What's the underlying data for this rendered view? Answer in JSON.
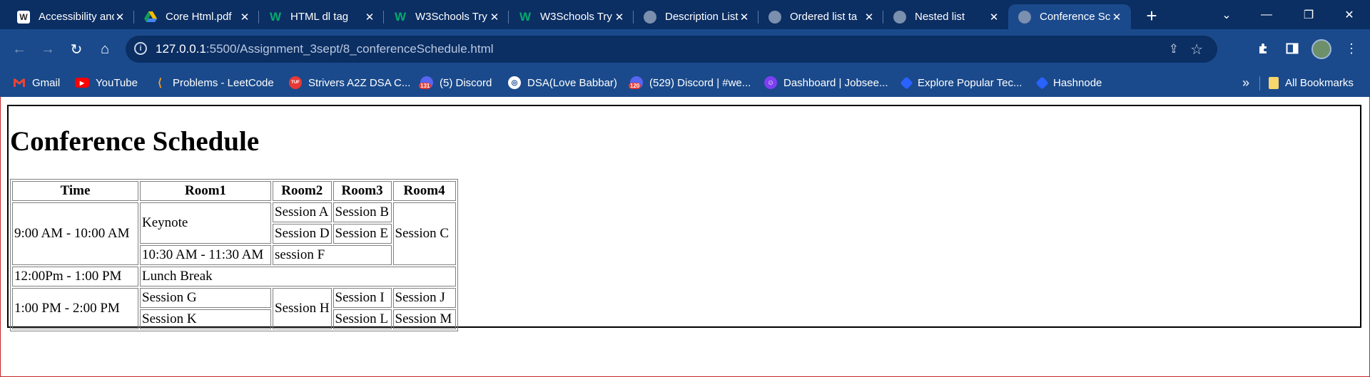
{
  "tabs": [
    {
      "title": "Accessibility and",
      "icon": "wordpress-icon",
      "active": false
    },
    {
      "title": "Core Html.pdf",
      "icon": "google-drive-icon",
      "active": false
    },
    {
      "title": "HTML dl tag",
      "icon": "w3schools-icon",
      "active": false
    },
    {
      "title": "W3Schools Try",
      "icon": "w3schools-icon",
      "active": false
    },
    {
      "title": "W3Schools Try",
      "icon": "w3schools-icon",
      "active": false
    },
    {
      "title": "Description List",
      "icon": "globe-icon",
      "active": false
    },
    {
      "title": "Ordered list ta",
      "icon": "globe-icon",
      "active": false
    },
    {
      "title": "Nested list",
      "icon": "globe-icon",
      "active": false
    },
    {
      "title": "Conference Sc",
      "icon": "globe-icon",
      "active": true
    }
  ],
  "address": {
    "host": "127.0.0.1",
    "path": ":5500/Assignment_3sept/8_conferenceSchedule.html"
  },
  "bookmarks": [
    {
      "label": "Gmail",
      "icon": "gmail-icon",
      "color": "#ea4335"
    },
    {
      "label": "YouTube",
      "icon": "youtube-icon",
      "color": "#ff0000"
    },
    {
      "label": "Problems - LeetCode",
      "icon": "leetcode-icon",
      "color": "#ffa116"
    },
    {
      "label": "Strivers A2Z DSA C...",
      "icon": "tuf-icon",
      "color": "#e53935"
    },
    {
      "label": "(5) Discord",
      "icon": "discord-icon",
      "badge": "131",
      "color": "#5865f2"
    },
    {
      "label": "DSA(Love Babbar)",
      "icon": "codehelp-icon",
      "color": "#ffffff"
    },
    {
      "label": "(529) Discord | #we...",
      "icon": "discord-icon",
      "badge": "120",
      "color": "#5865f2"
    },
    {
      "label": "Dashboard | Jobsee...",
      "icon": "jobseeker-icon",
      "color": "#7e3ff2"
    },
    {
      "label": "Explore Popular Tec...",
      "icon": "diamond-icon",
      "color": "#2962ff"
    },
    {
      "label": "Hashnode",
      "icon": "hashnode-icon",
      "color": "#2962ff"
    }
  ],
  "bookmarks_more": "»",
  "all_bookmarks": "All Bookmarks",
  "page": {
    "heading": "Conference Schedule",
    "headers": [
      "Time",
      "Room1",
      "Room2",
      "Room3",
      "Room4"
    ],
    "cells": {
      "t1": "9:00 AM - 10:00 AM",
      "keynote": "Keynote",
      "sessA": "Session A",
      "sessB": "Session B",
      "sessC": "Session C",
      "sessD": "Session D",
      "sessE": "Session E",
      "t2": "10:30 AM - 11:30 AM",
      "sessF": "session F",
      "t3": "12:00Pm - 1:00 PM",
      "lunch": "Lunch Break",
      "t4": "1:00 PM - 2:00 PM",
      "sessG": "Session G",
      "sessH": "Session H",
      "sessI": "Session I",
      "sessJ": "Session J",
      "sessK": "Session K",
      "sessL": "Session L",
      "sessM": "Session M"
    }
  }
}
